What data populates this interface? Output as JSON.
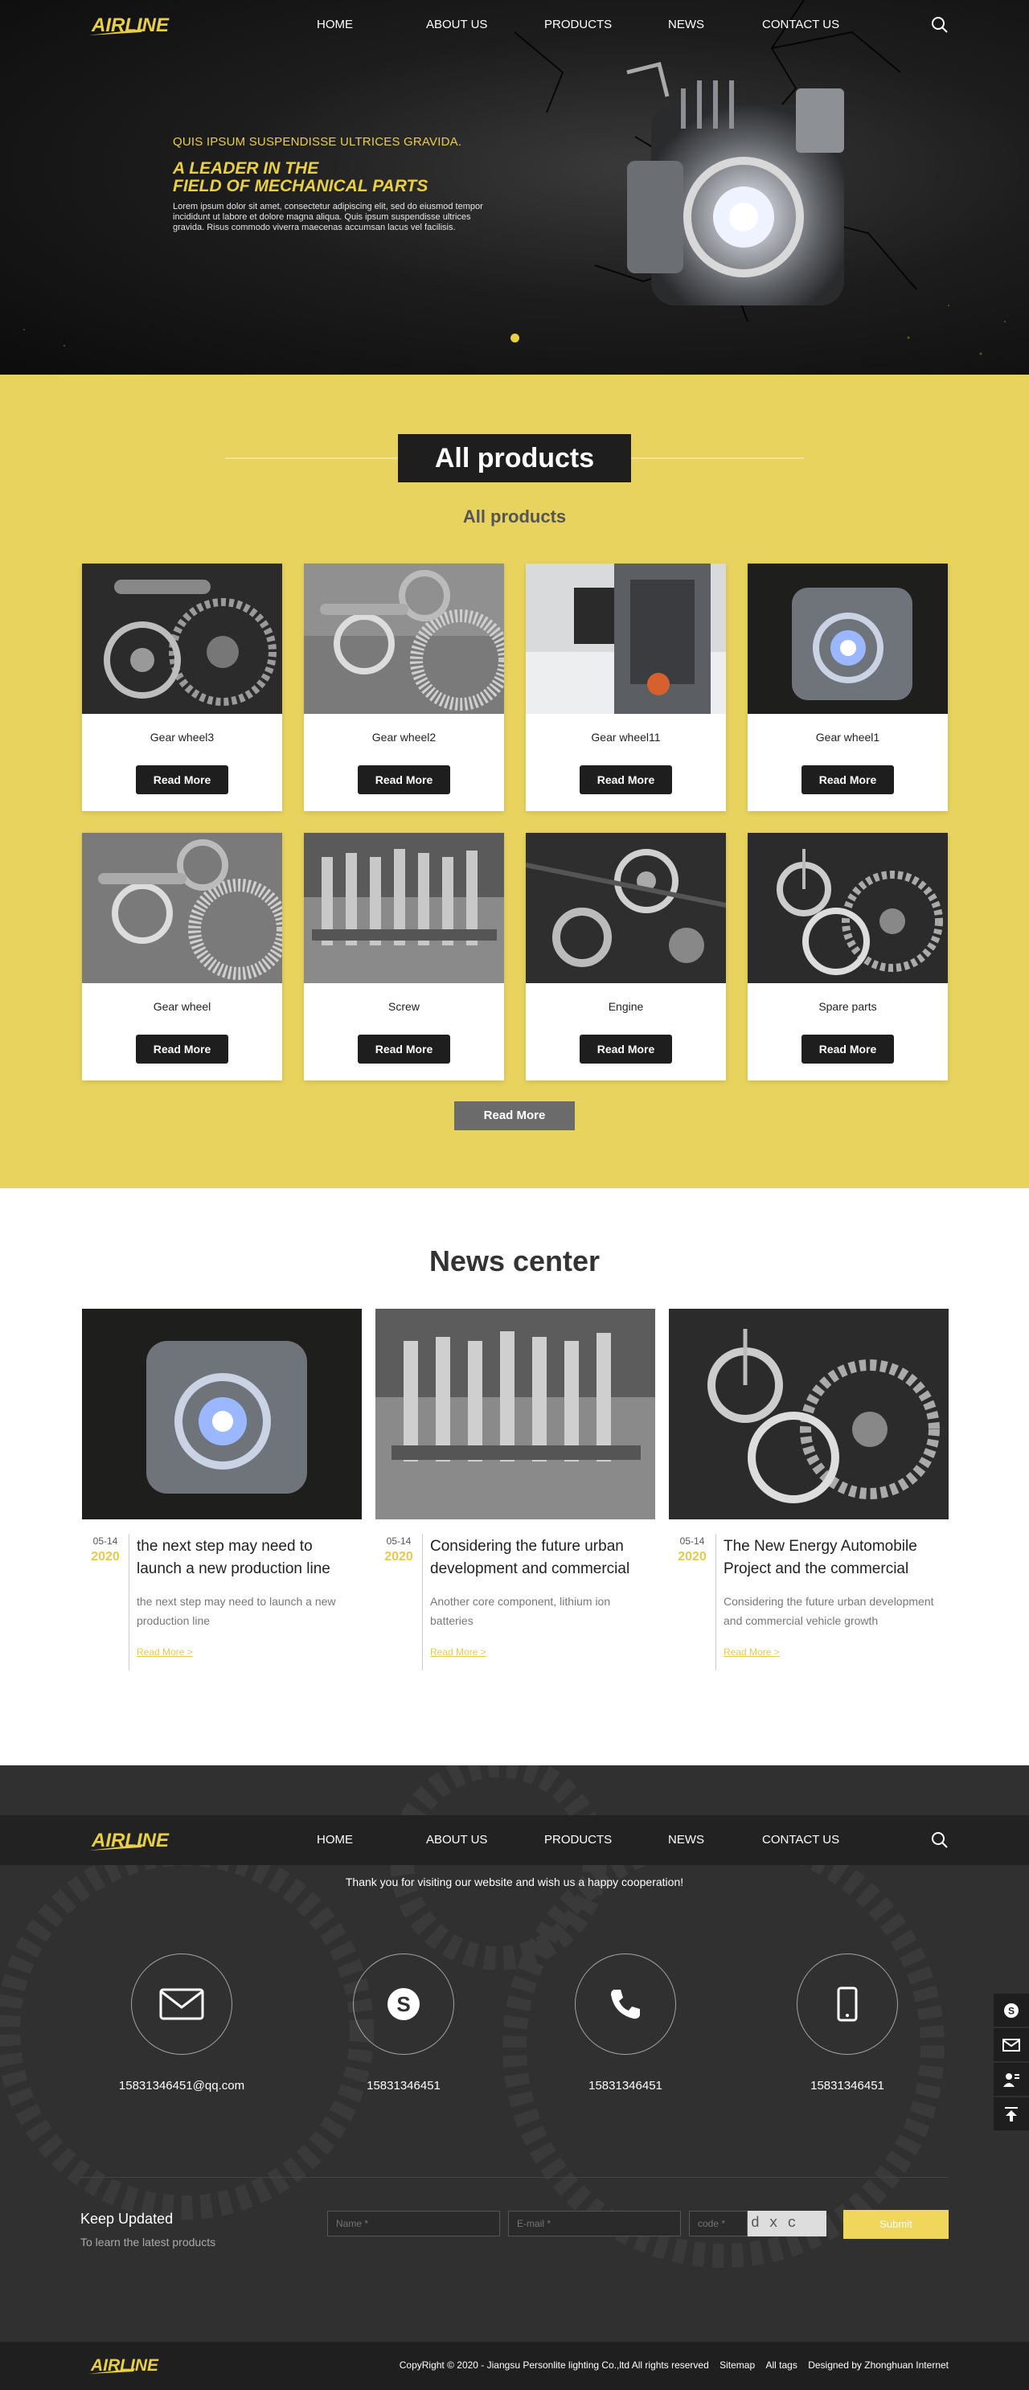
{
  "brand": {
    "logo_text": "AIRLINE",
    "accent_color": "#e9cf45"
  },
  "nav": {
    "items": [
      "HOME",
      "ABOUT US",
      "PRODUCTS",
      "NEWS",
      "CONTACT US"
    ],
    "search_icon": "search-icon"
  },
  "hero": {
    "eyebrow": "QUIS IPSUM SUSPENDISSE ULTRICES GRAVIDA.",
    "headline_1": "A LEADER IN THE",
    "headline_2": "FIELD OF MECHANICAL PARTS",
    "description": "Lorem ipsum dolor sit amet, consectetur adipiscing elit, sed do eiusmod tempor incididunt ut labore et dolore magna aliqua. Quis ipsum suspendisse ultrices gravida. Risus commodo viverra maecenas accumsan lacus vel facilisis."
  },
  "products": {
    "title": "All products",
    "subtitle": "All products",
    "button_label": "Read More",
    "more_label": "Read More",
    "items": [
      {
        "name": "Gear wheel3"
      },
      {
        "name": "Gear wheel2"
      },
      {
        "name": "Gear wheel11"
      },
      {
        "name": "Gear wheel1"
      },
      {
        "name": "Gear wheel"
      },
      {
        "name": "Screw"
      },
      {
        "name": "Engine"
      },
      {
        "name": "Spare parts"
      }
    ]
  },
  "news": {
    "title": "News center",
    "read_more": "Read More >",
    "items": [
      {
        "md": "05-14",
        "year": "2020",
        "title": "the next step may need to launch a new production line",
        "excerpt": "the next step may need to launch a new production line"
      },
      {
        "md": "05-14",
        "year": "2020",
        "title": "Considering the future urban development and commercial vehicle…",
        "excerpt": "Another core component, lithium ion batteries"
      },
      {
        "md": "05-14",
        "year": "2020",
        "title": "The New Energy Automobile Project and the commercial vehicle p…",
        "excerpt": "Considering the future urban development and commercial vehicle growth"
      }
    ]
  },
  "footer": {
    "thanks": "Thank you for visiting our website and wish us a happy cooperation!",
    "contacts": [
      {
        "icon": "mail-icon",
        "value": "15831346451@qq.com"
      },
      {
        "icon": "skype-icon",
        "value": "15831346451"
      },
      {
        "icon": "phone-icon",
        "value": "15831346451"
      },
      {
        "icon": "mobile-icon",
        "value": "15831346451"
      }
    ],
    "keep_updated": "Keep Updated",
    "keep_sub": "To learn the latest products",
    "name_placeholder": "Name *",
    "email_placeholder": "E-mail *",
    "code_placeholder": "code *",
    "captcha": "dxc",
    "submit": "Submit",
    "copyright": "CopyRight © 2020 - Jiangsu Personlite lighting Co.,ltd  All rights reserved",
    "sitemap": "Sitemap",
    "all_tags": "All tags",
    "designed_by": "Designed by Zhonghuan Internet"
  }
}
